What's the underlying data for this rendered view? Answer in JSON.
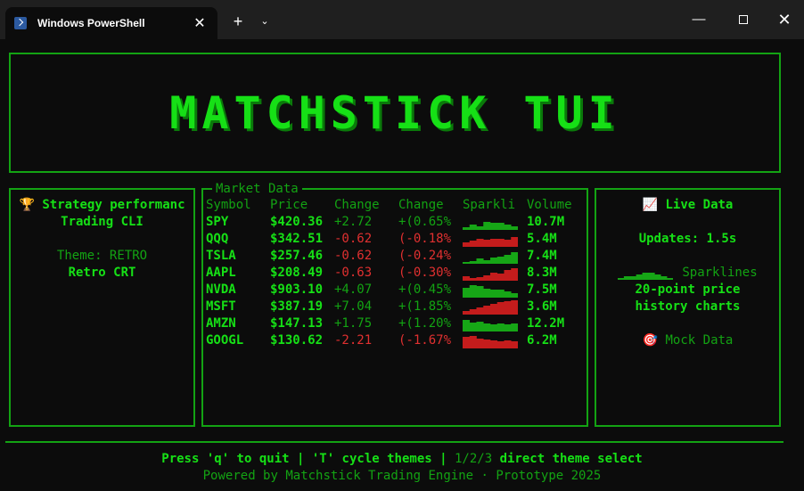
{
  "window": {
    "tab_title": "Windows PowerShell",
    "tab_close": "✕",
    "new_tab": "+",
    "dropdown": "⌄",
    "minimize": "—",
    "close": "✕"
  },
  "banner": {
    "title": "MATCHSTICK TUI"
  },
  "left_panel": {
    "trophy_icon": "🏆",
    "line1": "Strategy performanc",
    "line2": "Trading CLI",
    "theme_label": "Theme: RETRO",
    "theme_name": "Retro CRT"
  },
  "market": {
    "legend": "Market Data",
    "headers": [
      "Symbol",
      "Price",
      "Change",
      "Change",
      "Sparkli",
      "Volume"
    ],
    "rows": [
      {
        "symbol": "SPY",
        "price": "$420.36",
        "change": "+2.72",
        "pct": "+(0.65%",
        "volume": "10.7M",
        "up": true,
        "spark": [
          3,
          6,
          4,
          9,
          8,
          8,
          6,
          4
        ]
      },
      {
        "symbol": "QQQ",
        "price": "$342.51",
        "change": "-0.62",
        "pct": "(-0.18%",
        "volume": "5.4M",
        "up": false,
        "spark": [
          5,
          7,
          9,
          8,
          9,
          9,
          8,
          11
        ]
      },
      {
        "symbol": "TSLA",
        "price": "$257.46",
        "change": "-0.62",
        "pct": "(-0.24%",
        "volume": "7.4M",
        "up": true,
        "spark": [
          2,
          3,
          6,
          4,
          7,
          8,
          10,
          13
        ]
      },
      {
        "symbol": "AAPL",
        "price": "$208.49",
        "change": "-0.63",
        "pct": "(-0.30%",
        "volume": "8.3M",
        "up": false,
        "spark": [
          5,
          3,
          4,
          6,
          9,
          8,
          12,
          14
        ]
      },
      {
        "symbol": "NVDA",
        "price": "$903.10",
        "change": "+4.07",
        "pct": "+(0.45%",
        "volume": "7.5M",
        "up": true,
        "spark": [
          11,
          14,
          13,
          10,
          9,
          9,
          7,
          5
        ]
      },
      {
        "symbol": "MSFT",
        "price": "$387.19",
        "change": "+7.04",
        "pct": "+(1.85%",
        "volume": "3.6M",
        "up": false,
        "spark": [
          4,
          6,
          8,
          10,
          12,
          14,
          15,
          16
        ]
      },
      {
        "symbol": "AMZN",
        "price": "$147.13",
        "change": "+1.75",
        "pct": "+(1.20%",
        "volume": "12.2M",
        "up": true,
        "spark": [
          13,
          10,
          11,
          9,
          8,
          9,
          8,
          9
        ]
      },
      {
        "symbol": "GOOGL",
        "price": "$130.62",
        "change": "-2.21",
        "pct": "(-1.67%",
        "volume": "6.2M",
        "up": false,
        "spark": [
          13,
          14,
          11,
          10,
          9,
          8,
          9,
          8
        ]
      }
    ]
  },
  "right_panel": {
    "chart_icon": "📈",
    "live_label": "Live Data",
    "updates": "Updates: 1.5s",
    "sparklines_label": "Sparklines",
    "sparkline_sample": [
      2,
      4,
      4,
      6,
      8,
      8,
      6,
      4,
      2
    ],
    "price_line1": "20-point price",
    "price_line2": "history charts",
    "target_icon": "🎯",
    "mock_label": "Mock Data"
  },
  "footer": {
    "help_part1": "Press 'q' to quit | 'T' cycle themes |",
    "help_part2": " 1/2/3",
    "help_part3": " direct theme select",
    "powered": "Powered by Matchstick Trading Engine · Prototype 2025"
  },
  "colors": {
    "up": "#16a616",
    "down": "#c41c1c",
    "accent": "#16e016",
    "border": "#13a313"
  }
}
